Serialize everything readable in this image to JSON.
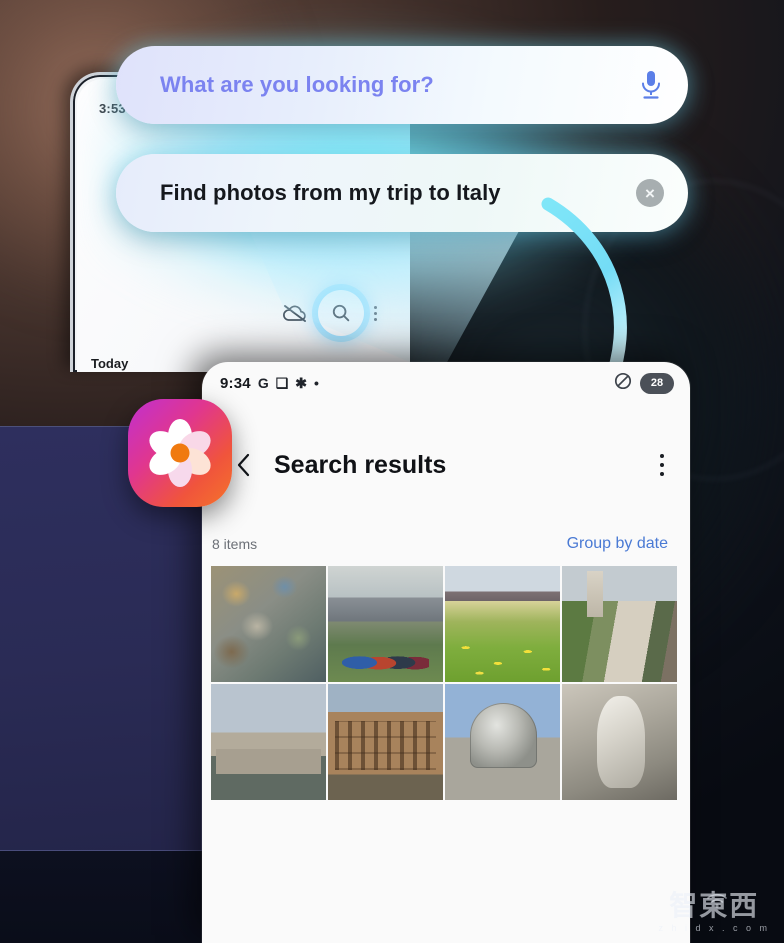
{
  "background": {
    "phone": {
      "status_time": "3:53",
      "section_label": "Today"
    },
    "toolbar": {
      "cloud_off_icon": "cloud-off-icon",
      "search_icon": "search-icon",
      "more_icon": "more-vertical-icon"
    }
  },
  "assistant": {
    "prompt": "What are you looking for?",
    "query": "Find photos from my trip to Italy",
    "mic_icon": "microphone-icon",
    "clear_icon": "close-circle-icon",
    "clear_label": "×",
    "accent_color": "#7b83f0",
    "glow_color": "#76f2ff"
  },
  "results_phone": {
    "status_bar": {
      "time": "9:34",
      "icons": [
        "google-g-icon",
        "image-icon",
        "snowflake-icon",
        "dot-icon"
      ],
      "google_glyph": "G",
      "image_glyph": "❑",
      "snowflake_glyph": "✱",
      "dot_glyph": "•",
      "mute_icon": "do-not-disturb-icon",
      "battery_level": "28"
    },
    "header": {
      "back_icon": "back-chevron-icon",
      "title": "Search results",
      "more_icon": "more-vertical-icon"
    },
    "meta": {
      "items_count": "8 items",
      "group_by": "Group by date",
      "group_by_color": "#4a7ad4"
    },
    "photos": [
      {
        "name": "mosaic-artwork",
        "class": "ph-mosaic"
      },
      {
        "name": "mountain-group-photo",
        "class": "ph-mountain"
      },
      {
        "name": "dolomites-meadow",
        "class": "ph-meadow"
      },
      {
        "name": "village-church-tower",
        "class": "ph-village"
      },
      {
        "name": "tiber-river-bridge",
        "class": "ph-bridge"
      },
      {
        "name": "colosseum",
        "class": "ph-colosseum"
      },
      {
        "name": "st-peters-basilica-dome",
        "class": "ph-dome"
      },
      {
        "name": "marble-statue-fountain",
        "class": "ph-statue"
      }
    ]
  },
  "gallery_app": {
    "icon_name": "samsung-gallery-icon"
  },
  "watermark": {
    "cn": "智東西",
    "en": "z h i d x . c o m"
  }
}
